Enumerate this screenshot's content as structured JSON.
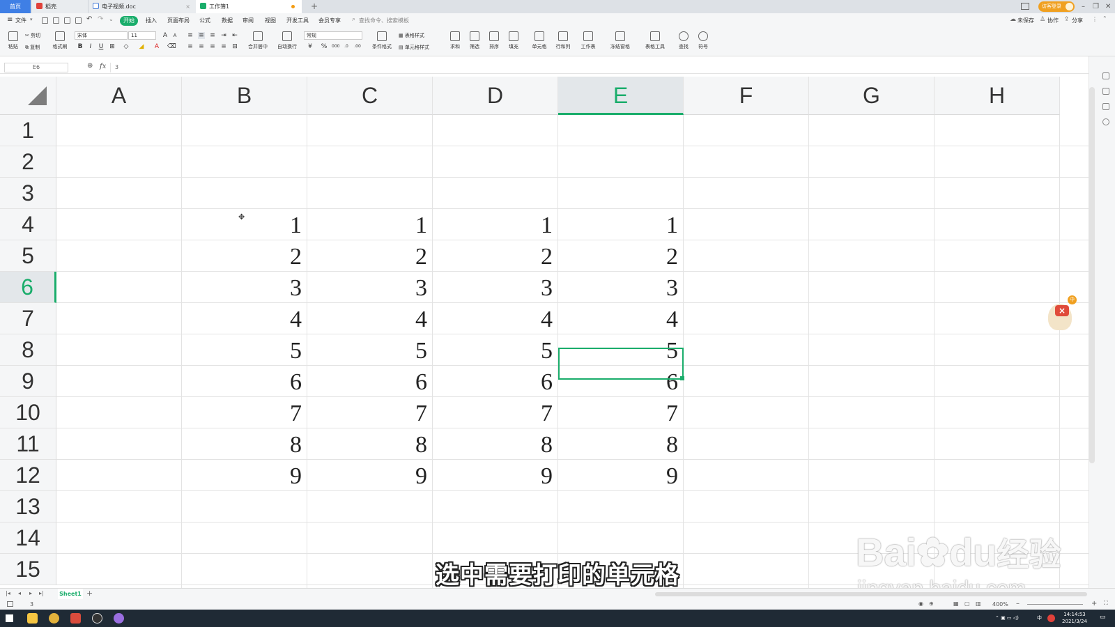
{
  "tabs": {
    "home": "首页",
    "daoke": "稻壳",
    "doc": "电子视频.doc",
    "sheet": "工作簿1",
    "new_tab": "+"
  },
  "titlebar": {
    "login": "访客登录"
  },
  "menu": {
    "file": "文件",
    "items": [
      "开始",
      "插入",
      "页面布局",
      "公式",
      "数据",
      "审阅",
      "视图",
      "开发工具",
      "会员专享"
    ],
    "search": "查找命令、搜索模板",
    "right": [
      "未保存",
      "协作",
      "分享"
    ]
  },
  "ribbon": {
    "paste": "粘贴",
    "cut": "剪切",
    "copy": "复制",
    "format_painter": "格式刷",
    "font_name": "宋体",
    "font_size": "11",
    "merge": "合并居中",
    "wrap": "自动换行",
    "number_format": "常规",
    "cond_format": "条件格式",
    "table_style": "表格样式",
    "cell_style": "单元格样式",
    "sum": "求和",
    "filter": "筛选",
    "sort": "排序",
    "fill": "填充",
    "cell": "单元格",
    "row_col": "行和列",
    "worksheet": "工作表",
    "freeze": "冻结窗格",
    "table_tools": "表格工具",
    "find": "查找",
    "symbol": "符号"
  },
  "formula_bar": {
    "name_box": "E6",
    "fx": "fx",
    "value": "3"
  },
  "columns": [
    "A",
    "B",
    "C",
    "D",
    "E",
    "F",
    "G",
    "H"
  ],
  "selected_column": "E",
  "rows": [
    "1",
    "2",
    "3",
    "4",
    "5",
    "6",
    "7",
    "8",
    "9",
    "10",
    "11",
    "12",
    "13",
    "14",
    "15"
  ],
  "selected_row": "6",
  "cells": {
    "B": [
      "1",
      "2",
      "3",
      "4",
      "5",
      "6",
      "7",
      "8",
      "9"
    ],
    "C": [
      "1",
      "2",
      "3",
      "4",
      "5",
      "6",
      "7",
      "8",
      "9"
    ],
    "D": [
      "1",
      "2",
      "3",
      "4",
      "5",
      "6",
      "7",
      "8",
      "9"
    ],
    "E": [
      "1",
      "2",
      "3",
      "4",
      "5",
      "6",
      "7",
      "8",
      "9"
    ]
  },
  "sheet_tabs": {
    "active": "Sheet1",
    "add": "+"
  },
  "status": {
    "value": "3",
    "zoom": "400%"
  },
  "taskbar": {
    "time": "14:14:53",
    "date": "2021/3/24",
    "ime": "中"
  },
  "subtitle": "选中需要打印的单元格",
  "watermark": {
    "brand": "Bai",
    "brand2": "du",
    "cn": "经验",
    "url": "jingyan.baidu.com"
  },
  "colors": {
    "accent": "#1aad6b",
    "tab_blue": "#3f7fe5",
    "login_orange": "#f0a020"
  }
}
